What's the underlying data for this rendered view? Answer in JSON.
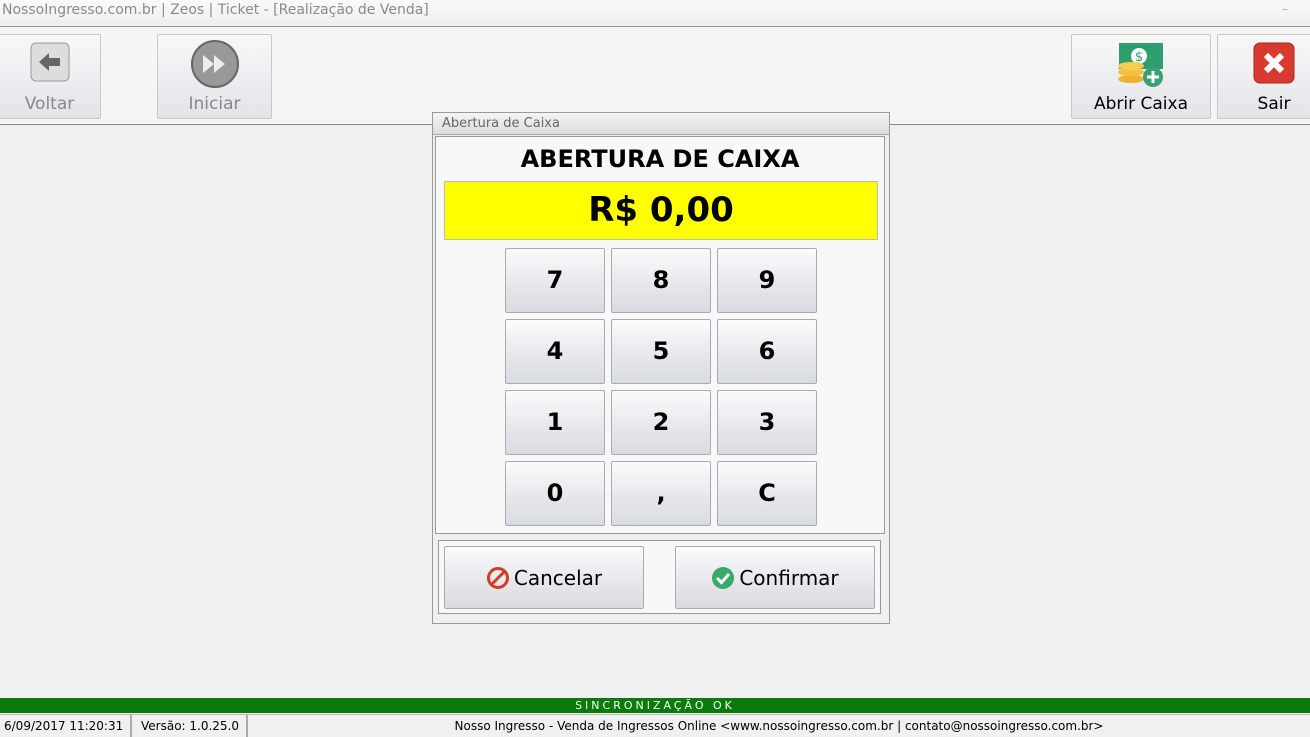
{
  "window": {
    "title": "NossoIngresso.com.br | Zeos | Ticket - [Realização de Venda]",
    "minimize": "–"
  },
  "toolbar": {
    "voltar": "Voltar",
    "iniciar": "Iniciar",
    "abrir_caixa": "Abrir Caixa",
    "sair": "Sair"
  },
  "dialog": {
    "title": "Abertura de Caixa",
    "heading": "ABERTURA DE CAIXA",
    "amount": "R$ 0,00",
    "keys": [
      "7",
      "8",
      "9",
      "4",
      "5",
      "6",
      "1",
      "2",
      "3",
      "0",
      ",",
      "C"
    ],
    "cancel": "Cancelar",
    "confirm": "Confirmar"
  },
  "status": {
    "sync": "SINCRONIZAÇÃO OK",
    "datetime": "6/09/2017 11:20:31",
    "version": "Versão: 1.0.25.0",
    "info": "Nosso Ingresso - Venda de Ingressos Online <www.nossoingresso.com.br | contato@nossoingresso.com.br>"
  },
  "colors": {
    "amount_bg": "#ffff00",
    "sync_bg": "#0a7a0a"
  }
}
